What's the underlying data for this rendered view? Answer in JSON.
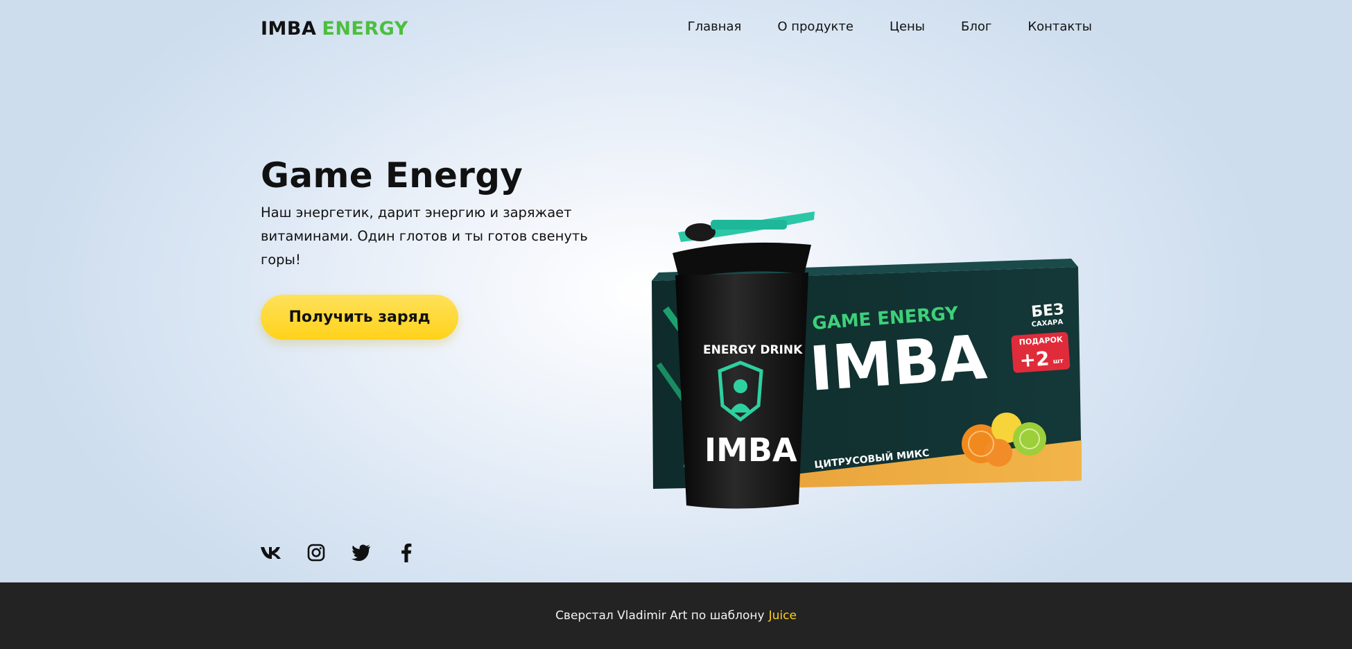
{
  "brand": {
    "part1": "IMBA",
    "part2": "ENERGY",
    "accent_color": "#4cbf3d"
  },
  "nav": {
    "items": [
      {
        "label": "Главная"
      },
      {
        "label": "О продукте"
      },
      {
        "label": "Цены"
      },
      {
        "label": "Блог"
      },
      {
        "label": "Контакты"
      }
    ]
  },
  "hero": {
    "title": "Game Energy",
    "description": "Наш энергетик, дарит энергию и заряжает витаминами. Один глотов и ты готов свенуть горы!",
    "cta_label": "Получить заряд",
    "cta_color": "#ffd21a"
  },
  "product_image": {
    "shaker_label": "ENERGY DRINK",
    "shaker_logo": "IMBA",
    "box_title": "GAME ENERGY",
    "box_logo": "IMBA",
    "box_badge_top": "БЕЗ",
    "box_badge_bottom": "САХАРА",
    "gift_label": "ПОДАРОК",
    "gift_value": "+2",
    "gift_unit": "шт",
    "flavor": "ЦИТРУСОВЫЙ МИКС"
  },
  "social": {
    "icons": [
      "vk-icon",
      "instagram-icon",
      "twitter-icon",
      "facebook-icon"
    ]
  },
  "footer": {
    "credit_text": "Сверстал Vladimir Art по шаблону",
    "credit_link": "Juice",
    "link_color": "#ffd21a",
    "background": "#232323"
  }
}
